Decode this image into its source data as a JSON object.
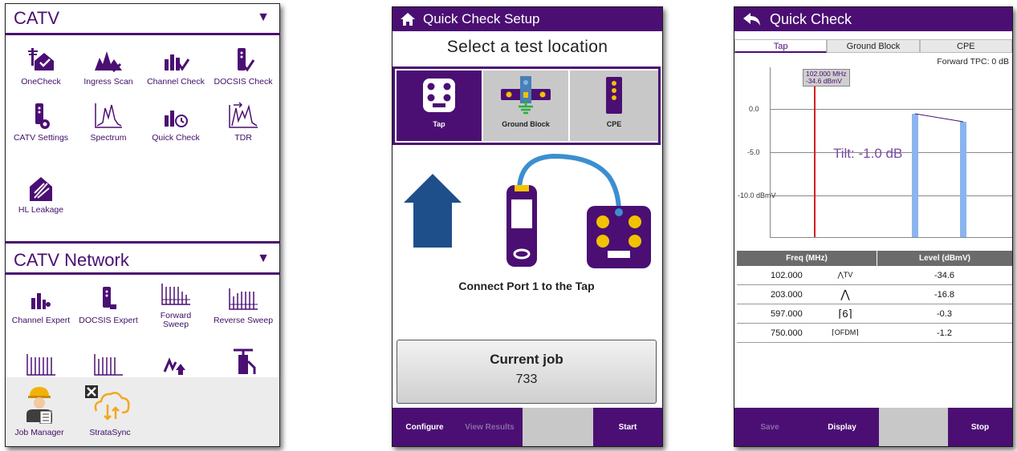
{
  "colors": {
    "purple": "#4b0f73",
    "accent_blue": "#8ab4ee",
    "marker_red": "#d42020",
    "gray_button": "#c8c8c8"
  },
  "catv": {
    "title": "CATV",
    "apps": [
      {
        "label": "OneCheck",
        "icon": "onecheck-icon"
      },
      {
        "label": "Ingress Scan",
        "icon": "ingress-scan-icon"
      },
      {
        "label": "Channel Check",
        "icon": "channel-check-icon"
      },
      {
        "label": "DOCSIS Check",
        "icon": "docsis-check-icon"
      },
      {
        "label": "CATV Settings",
        "icon": "catv-settings-icon"
      },
      {
        "label": "Spectrum",
        "icon": "spectrum-icon"
      },
      {
        "label": "Quick Check",
        "icon": "quick-check-icon"
      },
      {
        "label": "TDR",
        "icon": "tdr-icon"
      },
      {
        "label": "HL Leakage",
        "icon": "hl-leakage-icon"
      }
    ]
  },
  "catv_network": {
    "title": "CATV Network",
    "apps": [
      {
        "label": "Channel Expert",
        "icon": "channel-expert-icon"
      },
      {
        "label": "DOCSIS Expert",
        "icon": "docsis-expert-icon"
      },
      {
        "label": "Forward\nSweep",
        "icon": "forward-sweep-icon"
      },
      {
        "label": "Reverse Sweep",
        "icon": "reverse-sweep-icon"
      }
    ]
  },
  "dock": {
    "job_manager": "Job Manager",
    "stratasync": "StrataSync"
  },
  "quick_check_setup": {
    "title": "Quick Check Setup",
    "subtitle": "Select a test location",
    "locations": [
      "Tap",
      "Ground Block",
      "CPE"
    ],
    "connect_text": "Connect Port 1 to the Tap",
    "job_label": "Current job",
    "job_number": "733",
    "buttons": {
      "configure": "Configure",
      "view_results": "View Results",
      "start": "Start"
    }
  },
  "quick_check": {
    "title": "Quick Check",
    "tabs": [
      "Tap",
      "Ground Block",
      "CPE"
    ],
    "forward_tpc": "Forward TPC: 0 dB",
    "marker_freq": "102.000 MHz",
    "marker_level": "-34.6 dBmV",
    "y_ticks": [
      "0.0",
      "-5.0",
      "-10.0 dBmV"
    ],
    "tilt": "Tilt: -1.0 dB",
    "table": {
      "headers": [
        "Freq (MHz)",
        "Level (dBmV)"
      ],
      "rows": [
        {
          "freq": "102.000",
          "icon": "analog-tv-icon",
          "level": "-34.6"
        },
        {
          "freq": "203.000",
          "icon": "single-carrier-icon",
          "level": "-16.8"
        },
        {
          "freq": "597.000",
          "icon": "qam-256-icon",
          "level": "-0.3"
        },
        {
          "freq": "750.000",
          "icon": "ofdm-icon",
          "level": "-1.2"
        }
      ]
    },
    "buttons": {
      "save": "Save",
      "display": "Display",
      "stop": "Stop"
    }
  }
}
